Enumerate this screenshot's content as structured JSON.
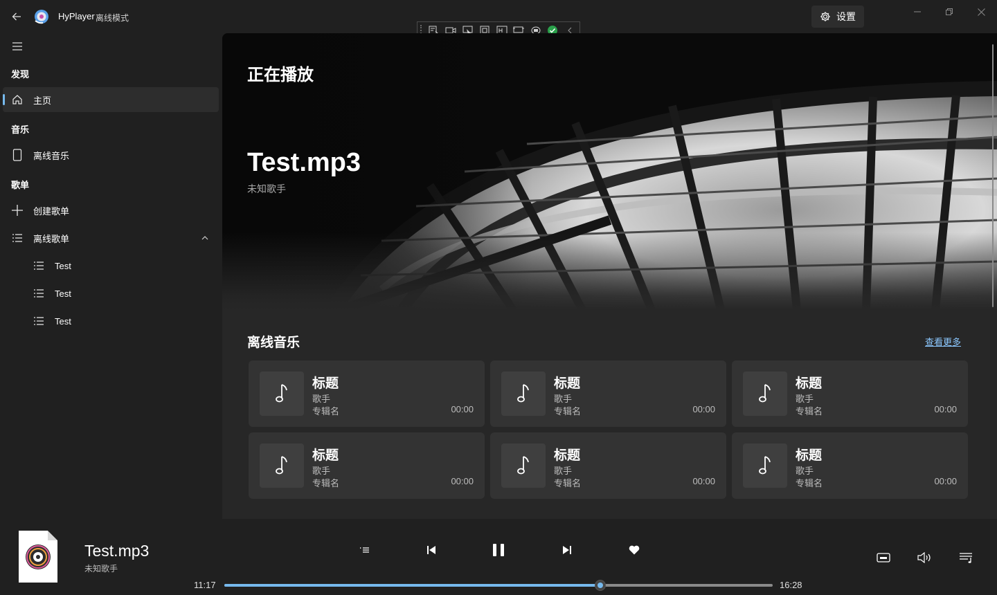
{
  "app": {
    "title": "HyPlayer",
    "mode": "离线模式",
    "settings_label": "设置",
    "accent_color": "#76b9ed"
  },
  "debug_toolbar": {
    "icons": [
      "live-tree-icon",
      "video-icon",
      "select-element-icon",
      "layout-adorner-icon",
      "track-focus-icon",
      "display-layout-icon",
      "hot-reload-icon",
      "status-ok-icon",
      "collapse-icon"
    ]
  },
  "sidebar": {
    "discover_header": "发现",
    "home_label": "主页",
    "music_header": "音乐",
    "offline_music_label": "离线音乐",
    "playlists_header": "歌单",
    "create_playlist_label": "创建歌单",
    "offline_playlists_label": "离线歌单",
    "playlists": [
      {
        "label": "Test"
      },
      {
        "label": "Test"
      },
      {
        "label": "Test"
      }
    ]
  },
  "hero": {
    "label": "正在播放",
    "song": "Test.mp3",
    "artist": "未知歌手"
  },
  "offline_section": {
    "title": "离线音乐",
    "see_more": "查看更多",
    "cards": [
      {
        "title": "标题",
        "artist": "歌手",
        "album": "专辑名",
        "duration": "00:00"
      },
      {
        "title": "标题",
        "artist": "歌手",
        "album": "专辑名",
        "duration": "00:00"
      },
      {
        "title": "标题",
        "artist": "歌手",
        "album": "专辑名",
        "duration": "00:00"
      },
      {
        "title": "标题",
        "artist": "歌手",
        "album": "专辑名",
        "duration": "00:00"
      },
      {
        "title": "标题",
        "artist": "歌手",
        "album": "专辑名",
        "duration": "00:00"
      },
      {
        "title": "标题",
        "artist": "歌手",
        "album": "专辑名",
        "duration": "00:00"
      }
    ]
  },
  "player": {
    "title": "Test.mp3",
    "artist": "未知歌手",
    "current_time": "11:17",
    "total_time": "16:28",
    "progress": 0.686
  }
}
